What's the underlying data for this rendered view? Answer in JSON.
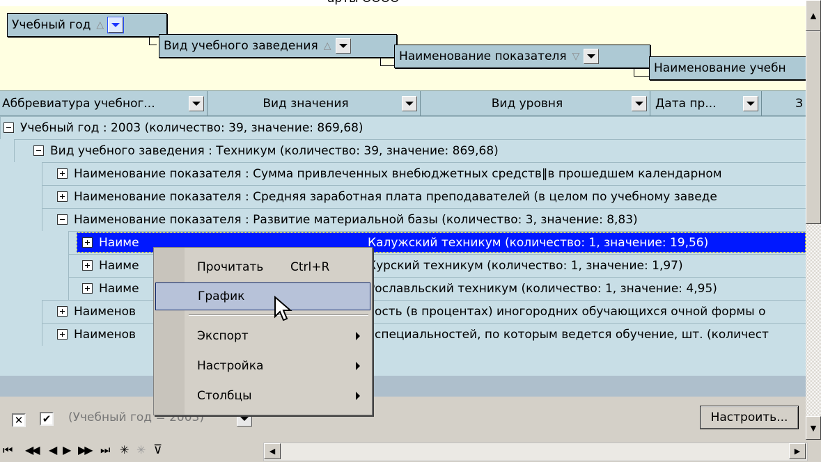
{
  "top_title_fragment": "арты ОООО",
  "group_panel": {
    "chips": [
      {
        "label": "Учебный год",
        "sort": "△"
      },
      {
        "label": "Вид учебного заведения",
        "sort": "△"
      },
      {
        "label": "Наименование показателя",
        "sort": "▽"
      },
      {
        "label": "Наименование учебн"
      }
    ]
  },
  "columns": [
    {
      "label": "Аббревиатура учебног..."
    },
    {
      "label": "Вид значения"
    },
    {
      "label": "Вид уровня"
    },
    {
      "label": "Дата пр..."
    },
    {
      "label": "З"
    }
  ],
  "rows": [
    {
      "text": "Учебный год : 2003 (количество: 39, значение: 869,68)"
    },
    {
      "text": "Вид учебного заведения : Техникум (количество: 39, значение: 869,68)"
    },
    {
      "text": "Наименование показателя : Сумма привлеченных внебюджетных средств‖в прошедшем календарном"
    },
    {
      "text": "Наименование показателя : Средняя заработная плата преподавателей (в целом по учебному заведе"
    },
    {
      "text": "Наименование показателя : Развитие материальной базы (количество: 3, значение: 8,83)"
    },
    {
      "text_start": "Наиме",
      "text_end": "Калужский техникум (количество: 1, значение: 19,56)"
    },
    {
      "text_start": "Наиме",
      "text_end": "Курский техникум (количество: 1, значение: 1,97)"
    },
    {
      "text_start": "Наиме",
      "text_end": "Рославльский техникум (количество: 1, значение: 4,95)"
    },
    {
      "text_start": "Наименов",
      "text_end": "ость (в процентах) иногородних обучающихся очной формы о"
    },
    {
      "text_start": "Наименов",
      "text_end": "специальностей, по которым ведется обучение, шт. (количест"
    }
  ],
  "context_menu": {
    "items": [
      {
        "label": "Прочитать",
        "shortcut": "Ctrl+R"
      },
      {
        "label": "График"
      },
      {
        "label": "Экспорт"
      },
      {
        "label": "Настройка"
      },
      {
        "label": "Столбцы"
      }
    ]
  },
  "filter_bar": {
    "close_glyph": "✕",
    "check_glyph": "✔",
    "filter_text": "(Учебный год = 2003)",
    "customize_label": "Настроить..."
  },
  "navigator": {
    "first": "⏮",
    "prev_page": "◀◀",
    "prev": "◀",
    "next": "▶",
    "next_page": "▶▶",
    "last": "⏭",
    "insert": "✳",
    "delete": "✳",
    "filter": "⊽"
  },
  "colors": {
    "group_panel_bg": "#ffffe1",
    "chip_bg": "#adc9d4",
    "grid_bg": "#c8dee6",
    "selection": "#0018ff",
    "menu_hover": "#b7c2d9"
  }
}
